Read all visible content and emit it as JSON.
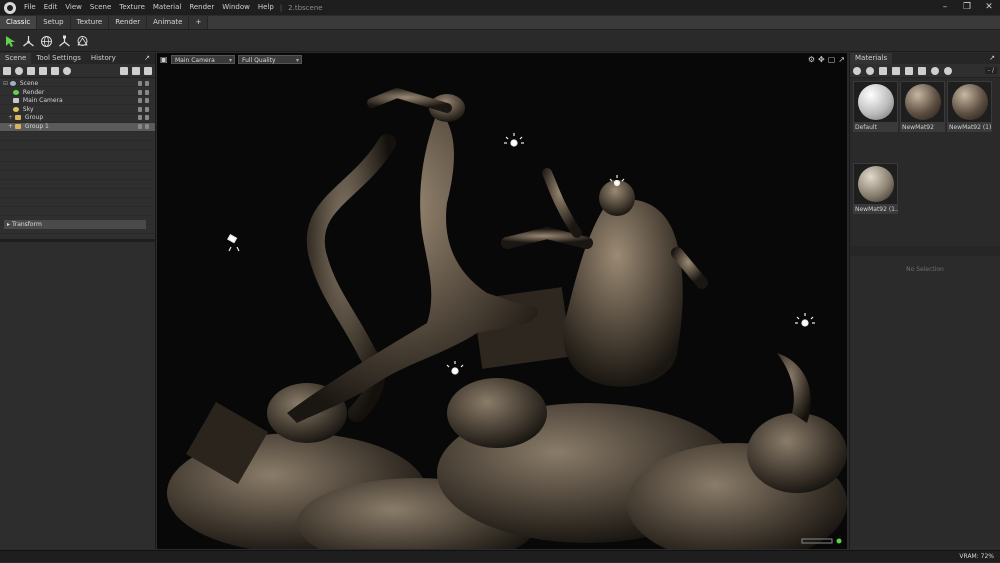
{
  "menubar": {
    "items": [
      "File",
      "Edit",
      "View",
      "Scene",
      "Texture",
      "Material",
      "Render",
      "Window",
      "Help"
    ],
    "separator": "|",
    "file_name": "2.tbscene"
  },
  "workspace_tabs": [
    "Classic",
    "Setup",
    "Texture",
    "Render",
    "Animate",
    "+"
  ],
  "left_panel": {
    "tabs": [
      "Scene",
      "Tool Settings",
      "History"
    ],
    "tree": [
      {
        "label": "Scene",
        "icon": "scene-icon"
      },
      {
        "label": "Render",
        "icon": "render-icon"
      },
      {
        "label": "Main Camera",
        "icon": "camera-icon"
      },
      {
        "label": "Sky",
        "icon": "sky-icon"
      },
      {
        "label": "Group",
        "icon": "folder-icon"
      },
      {
        "label": "Group 1",
        "icon": "folder-icon",
        "selected": true
      }
    ],
    "transform_label": "Transform"
  },
  "viewport": {
    "camera": "Main Camera",
    "quality": "Full Quality"
  },
  "right_panel": {
    "title": "Materials",
    "zoom_field": "- /",
    "materials": [
      {
        "label": "Default",
        "color": "#d9d9d9"
      },
      {
        "label": "NewMat92",
        "color": "#7a6a5c"
      },
      {
        "label": "NewMat92 (1)",
        "color": "#7a6a5c"
      },
      {
        "label": "NewMat92 (1...",
        "color": "#8f8678"
      }
    ],
    "no_selection": "No Selection"
  },
  "statusbar": {
    "vram": "VRAM: 72%"
  }
}
